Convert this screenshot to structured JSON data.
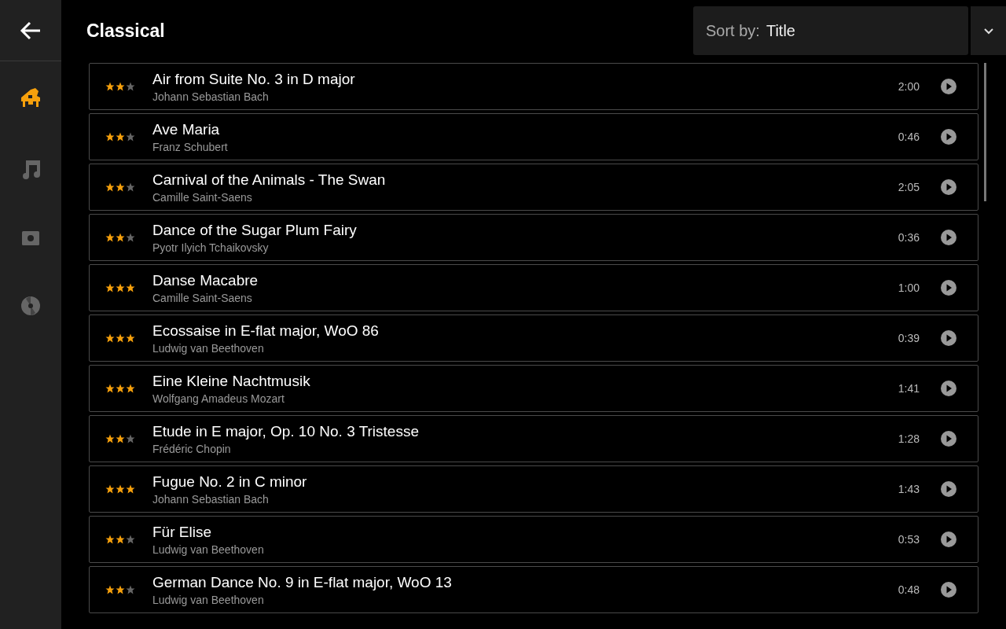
{
  "header": {
    "title": "Classical"
  },
  "sort": {
    "label": "Sort by:",
    "value": "Title"
  },
  "sidebar": {
    "items": [
      {
        "kind": "piano",
        "selected": true
      },
      {
        "kind": "note",
        "selected": false
      },
      {
        "kind": "camera",
        "selected": false
      },
      {
        "kind": "disc",
        "selected": false
      }
    ]
  },
  "tracks": [
    {
      "stars": 2,
      "title": "Air from Suite No. 3 in D major",
      "composer": "Johann Sebastian Bach",
      "duration": "2:00"
    },
    {
      "stars": 2,
      "title": "Ave Maria",
      "composer": "Franz Schubert",
      "duration": "0:46"
    },
    {
      "stars": 2,
      "title": "Carnival of the Animals - The Swan",
      "composer": "Camille Saint-Saens",
      "duration": "2:05"
    },
    {
      "stars": 2,
      "title": "Dance of the Sugar Plum Fairy",
      "composer": "Pyotr Ilyich Tchaikovsky",
      "duration": "0:36"
    },
    {
      "stars": 3,
      "title": "Danse Macabre",
      "composer": "Camille Saint-Saens",
      "duration": "1:00"
    },
    {
      "stars": 3,
      "title": "Ecossaise in E-flat major, WoO 86",
      "composer": "Ludwig van Beethoven",
      "duration": "0:39"
    },
    {
      "stars": 3,
      "title": "Eine Kleine Nachtmusik",
      "composer": "Wolfgang Amadeus Mozart",
      "duration": "1:41"
    },
    {
      "stars": 2,
      "title": "Etude in E major, Op. 10 No. 3 Tristesse",
      "composer": "Frédéric Chopin",
      "duration": "1:28"
    },
    {
      "stars": 3,
      "title": "Fugue No. 2 in C minor",
      "composer": "Johann Sebastian Bach",
      "duration": "1:43"
    },
    {
      "stars": 2,
      "title": "Für Elise",
      "composer": "Ludwig van Beethoven",
      "duration": "0:53"
    },
    {
      "stars": 2,
      "title": "German Dance No. 9 in E-flat major, WoO 13",
      "composer": "Ludwig van Beethoven",
      "duration": "0:48"
    }
  ]
}
